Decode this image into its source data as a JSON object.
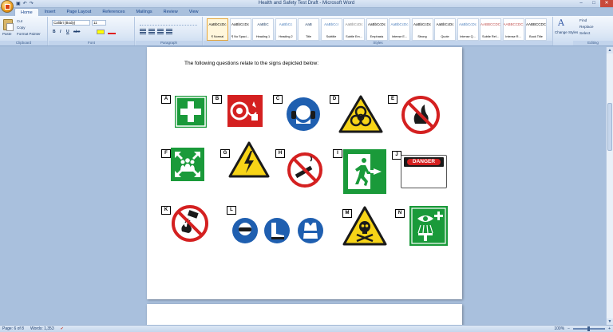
{
  "titlebar": {
    "title": "Health and Safety Test Draft - Microsoft Word",
    "qat_icons": [
      "save-icon",
      "undo-icon",
      "redo-icon"
    ],
    "controls": [
      "–",
      "□",
      "✕"
    ]
  },
  "tabs": [
    "Home",
    "Insert",
    "Page Layout",
    "References",
    "Mailings",
    "Review",
    "View"
  ],
  "active_tab": "Home",
  "ribbon": {
    "clipboard": {
      "label": "Clipboard",
      "paste": "Paste",
      "cut": "Cut",
      "copy": "Copy",
      "format_painter": "Format Painter"
    },
    "font": {
      "label": "Font",
      "family": "Calibri (Body)",
      "size": "11",
      "bold": "B",
      "italic": "I",
      "underline": "U",
      "strike": "abe"
    },
    "paragraph": {
      "label": "Paragraph"
    },
    "styles": {
      "label": "Styles",
      "items": [
        {
          "sample": "AaBbCcDc",
          "name": "¶ Normal",
          "color": "#000000"
        },
        {
          "sample": "AaBbCcDc",
          "name": "¶ No Spaci...",
          "color": "#000000"
        },
        {
          "sample": "AaBbC",
          "name": "Heading 1",
          "color": "#17365d"
        },
        {
          "sample": "AaBbCc",
          "name": "Heading 2",
          "color": "#4f81bd"
        },
        {
          "sample": "AaB",
          "name": "Title",
          "color": "#17365d"
        },
        {
          "sample": "AaBbCcI",
          "name": "Subtitle",
          "color": "#4f81bd"
        },
        {
          "sample": "AaBbCcDc",
          "name": "Subtle Em...",
          "color": "#808080"
        },
        {
          "sample": "AaBbCcDc",
          "name": "Emphasis",
          "color": "#000000"
        },
        {
          "sample": "AaBbCcDc",
          "name": "Intense E...",
          "color": "#4f81bd"
        },
        {
          "sample": "AaBbCcDc",
          "name": "Strong",
          "color": "#000000"
        },
        {
          "sample": "AaBbCcDc",
          "name": "Quote",
          "color": "#000000"
        },
        {
          "sample": "AaBbCcDc",
          "name": "Intense Q...",
          "color": "#4f81bd"
        },
        {
          "sample": "AABBCCDC",
          "name": "Subtle Ref...",
          "color": "#c0504d"
        },
        {
          "sample": "AABBCCDC",
          "name": "Intense R...",
          "color": "#c0504d"
        },
        {
          "sample": "AABBCCDC",
          "name": "Book Title",
          "color": "#000000"
        }
      ],
      "change_styles": "Change Styles"
    },
    "editing": {
      "label": "Editing",
      "find": "Find",
      "replace": "Replace",
      "select": "Select"
    }
  },
  "document": {
    "intro": "The following questions relate to the signs depicted below:",
    "signs": [
      {
        "letter": "A",
        "icon": "first-aid-sign"
      },
      {
        "letter": "B",
        "icon": "fire-hose-reel-sign"
      },
      {
        "letter": "C",
        "icon": "ear-protection-sign"
      },
      {
        "letter": "D",
        "icon": "biohazard-warning-sign"
      },
      {
        "letter": "E",
        "icon": "no-open-flame-sign"
      },
      {
        "letter": "F",
        "icon": "assembly-point-sign"
      },
      {
        "letter": "G",
        "icon": "electrical-hazard-sign"
      },
      {
        "letter": "H",
        "icon": "no-smoking-sign"
      },
      {
        "letter": "I",
        "icon": "emergency-exit-sign"
      },
      {
        "letter": "J",
        "icon": "danger-sign",
        "text": "DANGER"
      },
      {
        "letter": "K",
        "icon": "no-water-on-fire-sign"
      },
      {
        "letter": "L",
        "icon": "ppe-mandatory-signs"
      },
      {
        "letter": "M",
        "icon": "toxic-warning-sign"
      },
      {
        "letter": "N",
        "icon": "eyewash-station-sign"
      }
    ]
  },
  "statusbar": {
    "page": "Page: 6 of 8",
    "words": "Words: 1,353",
    "zoom": "100%"
  },
  "colors": {
    "safe_green": "#1a9a3a",
    "prohibit_red": "#d42020",
    "mandatory_blue": "#1f5fb0",
    "warning_yellow": "#f7d417"
  }
}
